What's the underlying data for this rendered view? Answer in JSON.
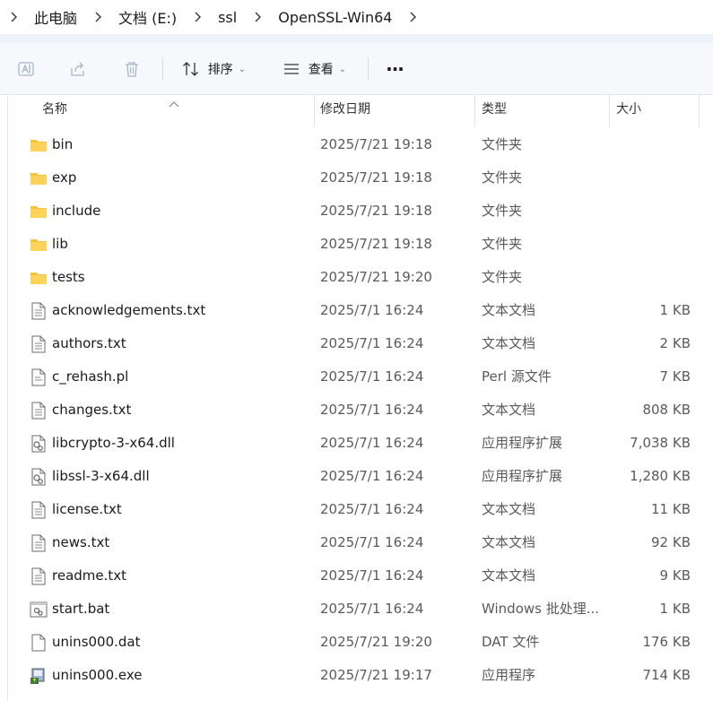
{
  "breadcrumb": [
    "此电脑",
    "文档 (E:)",
    "ssl",
    "OpenSSL-Win64"
  ],
  "toolbar": {
    "sort_label": "排序",
    "view_label": "查看",
    "more_label": "···"
  },
  "columns": {
    "name": "名称",
    "date": "修改日期",
    "type": "类型",
    "size": "大小"
  },
  "colors": {
    "folder": "#f5c342",
    "toolbar_bg": "#f6f8fc",
    "band": "#eef2f9"
  },
  "files": [
    {
      "name": "bin",
      "date": "2025/7/21 19:18",
      "type": "文件夹",
      "size": "",
      "icon": "folder-icon"
    },
    {
      "name": "exp",
      "date": "2025/7/21 19:18",
      "type": "文件夹",
      "size": "",
      "icon": "folder-icon"
    },
    {
      "name": "include",
      "date": "2025/7/21 19:18",
      "type": "文件夹",
      "size": "",
      "icon": "folder-icon"
    },
    {
      "name": "lib",
      "date": "2025/7/21 19:18",
      "type": "文件夹",
      "size": "",
      "icon": "folder-icon"
    },
    {
      "name": "tests",
      "date": "2025/7/21 19:20",
      "type": "文件夹",
      "size": "",
      "icon": "folder-icon"
    },
    {
      "name": "acknowledgements.txt",
      "date": "2025/7/1 16:24",
      "type": "文本文档",
      "size": "1 KB",
      "icon": "text-file-icon"
    },
    {
      "name": "authors.txt",
      "date": "2025/7/1 16:24",
      "type": "文本文档",
      "size": "2 KB",
      "icon": "text-file-icon"
    },
    {
      "name": "c_rehash.pl",
      "date": "2025/7/1 16:24",
      "type": "Perl 源文件",
      "size": "7 KB",
      "icon": "script-file-icon"
    },
    {
      "name": "changes.txt",
      "date": "2025/7/1 16:24",
      "type": "文本文档",
      "size": "808 KB",
      "icon": "text-file-icon"
    },
    {
      "name": "libcrypto-3-x64.dll",
      "date": "2025/7/1 16:24",
      "type": "应用程序扩展",
      "size": "7,038 KB",
      "icon": "dll-file-icon"
    },
    {
      "name": "libssl-3-x64.dll",
      "date": "2025/7/1 16:24",
      "type": "应用程序扩展",
      "size": "1,280 KB",
      "icon": "dll-file-icon"
    },
    {
      "name": "license.txt",
      "date": "2025/7/1 16:24",
      "type": "文本文档",
      "size": "11 KB",
      "icon": "text-file-icon"
    },
    {
      "name": "news.txt",
      "date": "2025/7/1 16:24",
      "type": "文本文档",
      "size": "92 KB",
      "icon": "text-file-icon"
    },
    {
      "name": "readme.txt",
      "date": "2025/7/1 16:24",
      "type": "文本文档",
      "size": "9 KB",
      "icon": "text-file-icon"
    },
    {
      "name": "start.bat",
      "date": "2025/7/1 16:24",
      "type": "Windows 批处理...",
      "size": "1 KB",
      "icon": "batch-file-icon"
    },
    {
      "name": "unins000.dat",
      "date": "2025/7/21 19:20",
      "type": "DAT 文件",
      "size": "176 KB",
      "icon": "blank-file-icon"
    },
    {
      "name": "unins000.exe",
      "date": "2025/7/21 19:17",
      "type": "应用程序",
      "size": "714 KB",
      "icon": "installer-icon"
    }
  ]
}
